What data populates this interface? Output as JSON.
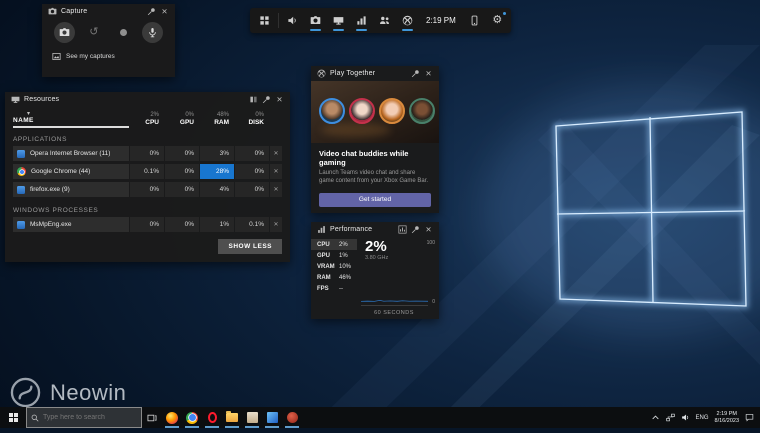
{
  "icons": {
    "close": "✕",
    "sort_caret": "▾",
    "gear": "⚙",
    "restart": "↺"
  },
  "capture_panel": {
    "title": "Capture",
    "footer_label": "See my captures"
  },
  "toolbar": {
    "time": "2:19 PM"
  },
  "resources_panel": {
    "title": "Resources",
    "name_column": "NAME",
    "columns": [
      {
        "total": "2%",
        "label": "CPU"
      },
      {
        "total": "0%",
        "label": "GPU"
      },
      {
        "total": "48%",
        "label": "RAM"
      },
      {
        "total": "0%",
        "label": "DISK"
      }
    ],
    "applications_label": "APPLICATIONS",
    "applications": [
      {
        "name": "Opera Internet Browser (11)",
        "cpu": "0%",
        "gpu": "0%",
        "ram": "3%",
        "disk": "0%"
      },
      {
        "name": "Google Chrome (44)",
        "cpu": "0.1%",
        "gpu": "0%",
        "ram": "28%",
        "disk": "0%"
      },
      {
        "name": "firefox.exe (9)",
        "cpu": "0%",
        "gpu": "0%",
        "ram": "4%",
        "disk": "0%"
      }
    ],
    "processes_label": "WINDOWS PROCESSES",
    "processes": [
      {
        "name": "MsMpEng.exe",
        "cpu": "0%",
        "gpu": "0%",
        "ram": "1%",
        "disk": "0.1%"
      }
    ],
    "show_less_label": "SHOW LESS",
    "highlight_color": "#1876cf"
  },
  "play_together_panel": {
    "title": "Play Together",
    "heading": "Video chat buddies while gaming",
    "description": "Launch Teams video chat and share game content from your Xbox Game Bar.",
    "cta_label": "Get started",
    "cta_color": "#6264a7"
  },
  "performance_panel": {
    "title": "Performance",
    "selected_metric": "CPU",
    "metrics": [
      {
        "label": "CPU",
        "value": "2%"
      },
      {
        "label": "GPU",
        "value": "1%"
      },
      {
        "label": "VRAM",
        "value": "10%"
      },
      {
        "label": "RAM",
        "value": "46%"
      },
      {
        "label": "FPS",
        "value": "--"
      }
    ],
    "big_value": "2%",
    "big_sub": "3.80 GHz",
    "axis_max": "100",
    "axis_min": "0",
    "axis_label": "60 SECONDS",
    "line_color": "#2f7fd6"
  },
  "taskbar": {
    "search_placeholder": "Type here to search",
    "tray_language": "ENG",
    "tray_time": "2:19 PM",
    "tray_date": "8/16/2023"
  },
  "watermark": {
    "text": "Neowin"
  }
}
